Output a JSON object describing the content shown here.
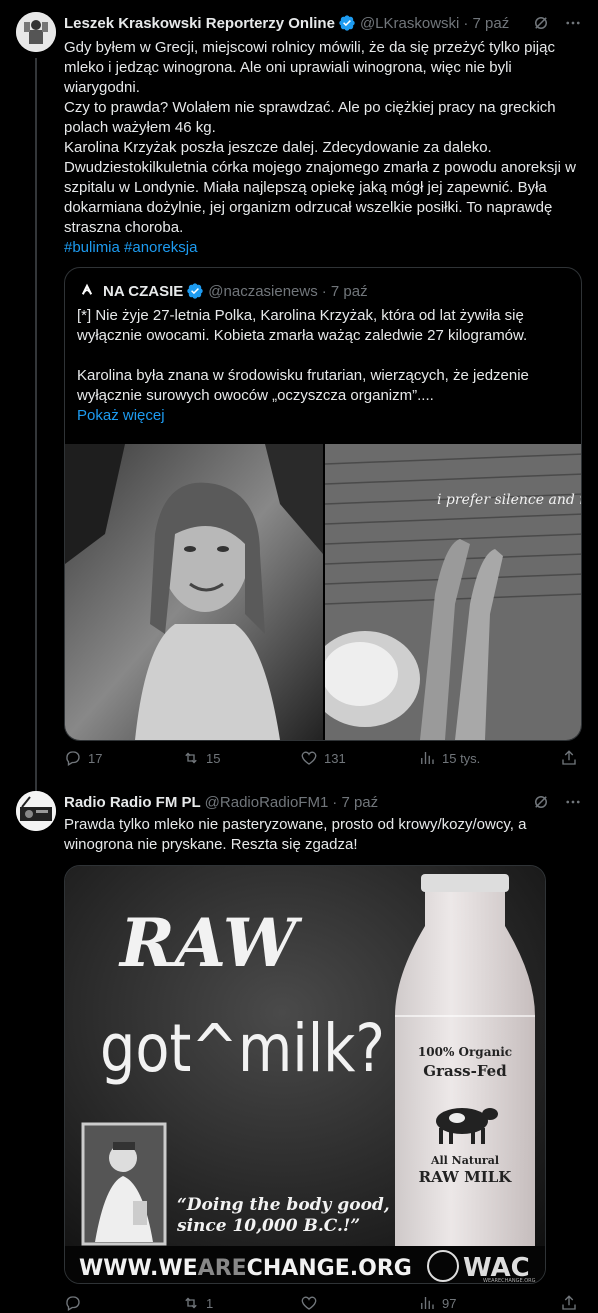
{
  "tweet1": {
    "author": "Leszek Kraskowski Reporterzy Online",
    "handle": "@LKraskowski",
    "time": "· 7 paź",
    "lines": [
      "Gdy byłem w Grecji, miejscowi rolnicy  mówili, że da się przeżyć tylko pijąc mleko i jedząc winogrona. Ale oni uprawiali winogrona, więc nie byli wiarygodni.",
      "Czy to prawda? Wolałem nie sprawdzać. Ale po ciężkiej pracy na greckich polach ważyłem 46 kg.",
      "Karolina Krzyżak poszła jeszcze dalej. Zdecydowanie za daleko. Dwudziestokilkuletnia córka mojego znajomego zmarła z powodu anoreksji w szpitalu w Londynie. Miała najlepszą opiekę jaką mógł jej zapewnić. Była dokarmiana dożylnie, jej organizm odrzucał wszelkie posiłki. To naprawdę straszna choroba."
    ],
    "hashtags": "#bulimia #anoreksja",
    "quote": {
      "author": "NA CZASIE",
      "handle": "@naczasienews",
      "time": "· 7 paź",
      "para1": "[*] Nie żyje 27-letnia Polka, Karolina Krzyżak, która od lat żywiła się wyłącznie owocami. Kobieta zmarła ważąc zaledwie 27 kilogramów.",
      "para2": "Karolina była znana w środowisku frutarian, wierzących, że jedzenie wyłącznie surowych owoców „oczyszcza organizm”....",
      "show_more": "Pokaż więcej",
      "photo2_caption": "i prefer silence and nature 🤍"
    },
    "actions": {
      "replies": "17",
      "retweets": "15",
      "likes": "131",
      "views": "15 tys."
    }
  },
  "tweet2": {
    "author": "Radio Radio FM PL",
    "handle": "@RadioRadioFM1",
    "time": "· 7 paź",
    "text": "Prawda tylko mleko nie pasteryzowane, prosto od krowy/kozy/owcy, a winogrona nie pryskane. Reszta się zgadza!",
    "poster": {
      "raw": "RAW",
      "got": "got^milk?",
      "label1": "100% Organic",
      "label2": "Grass-Fed",
      "label3": "All Natural",
      "label4": "RAW MILK",
      "slogan1": "“Doing the body good,",
      "slogan2": "since 10,000 B.C.!”",
      "url_pre": "WWW.WE",
      "url_are": "ARE",
      "url_post": "CHANGE.ORG",
      "logo": "WAC",
      "logo_sub": "WEARECHANGE.ORG"
    },
    "actions": {
      "replies": "",
      "retweets": "1",
      "likes": "",
      "views": "97"
    }
  },
  "colors": {
    "accent": "#1d9bf0",
    "muted": "#71767b",
    "border": "#2f3336",
    "verified": "#1d9bf0"
  },
  "icons": [
    "reply-icon",
    "retweet-icon",
    "like-icon",
    "views-icon",
    "grok-icon",
    "more-icon",
    "verified-icon"
  ]
}
